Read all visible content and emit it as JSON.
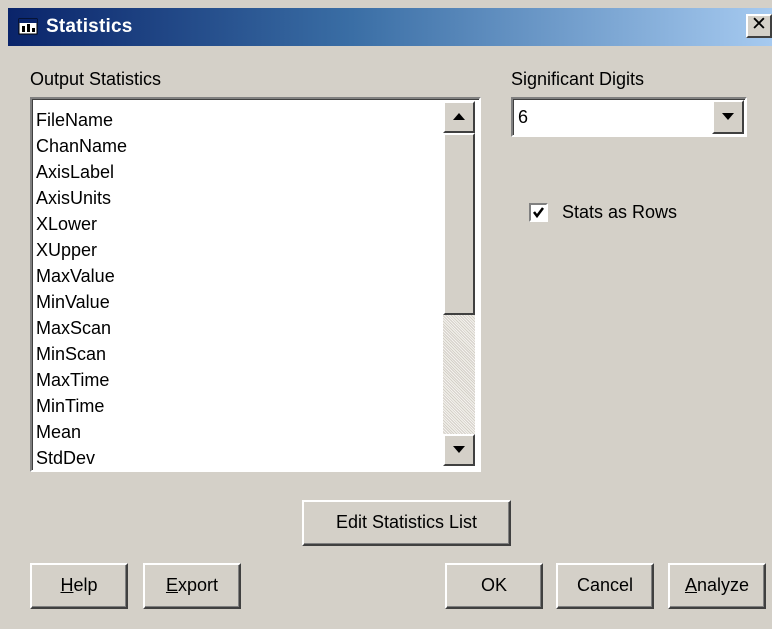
{
  "window": {
    "title": "Statistics",
    "close_glyph": "✕"
  },
  "output_statistics": {
    "label": "Output Statistics",
    "items": [
      "FileName",
      "ChanName",
      "AxisLabel",
      "AxisUnits",
      "XLower",
      "XUpper",
      "MaxValue",
      "MinValue",
      "MaxScan",
      "MinScan",
      "MaxTime",
      "MinTime",
      "Mean",
      "StdDev"
    ]
  },
  "significant_digits": {
    "label": "Significant Digits",
    "value": "6"
  },
  "stats_as_rows": {
    "label": "Stats as Rows",
    "checked": true
  },
  "buttons": {
    "edit_statistics_list": "Edit Statistics List",
    "help": {
      "mnemonic": "H",
      "rest": "elp"
    },
    "export": {
      "mnemonic": "E",
      "rest": "xport"
    },
    "ok": "OK",
    "cancel": "Cancel",
    "analyze": {
      "mnemonic": "A",
      "rest": "nalyze"
    }
  },
  "icons": [
    "window-app-icon",
    "close-icon",
    "scroll-up-arrow-icon",
    "scroll-down-arrow-icon",
    "dropdown-arrow-icon",
    "checkmark-icon"
  ]
}
